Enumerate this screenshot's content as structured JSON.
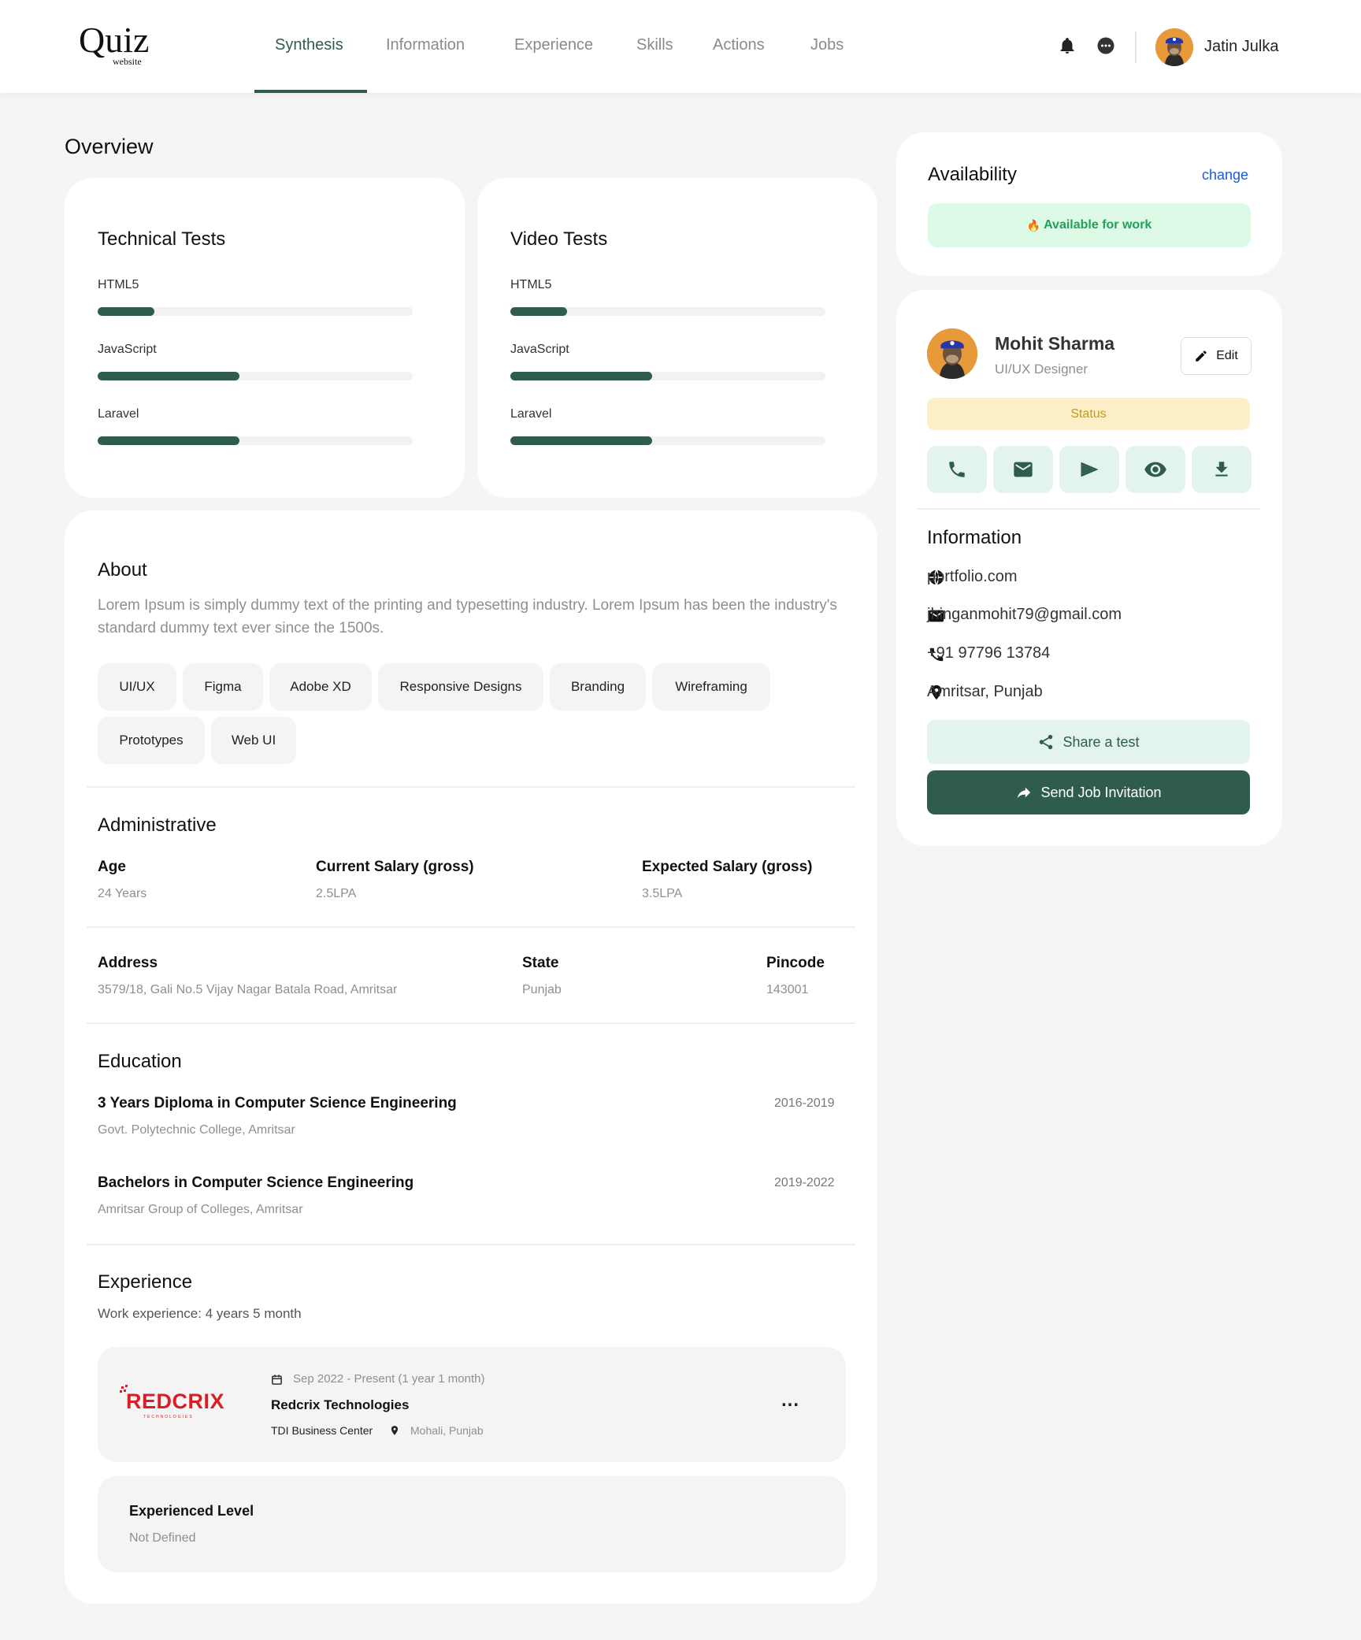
{
  "brand": {
    "name": "Quiz",
    "tagline": "website"
  },
  "nav": {
    "items": [
      "Synthesis",
      "Information",
      "Experience",
      "Skills",
      "Actions",
      "Jobs"
    ],
    "active": "Synthesis"
  },
  "header": {
    "user_name": "Jatin Julka",
    "icons": [
      "bell-icon",
      "chat-icon"
    ]
  },
  "overview": {
    "title": "Overview"
  },
  "technical_tests": {
    "title": "Technical Tests",
    "items": [
      {
        "label": "HTML5",
        "level": 0.18
      },
      {
        "label": "JavaScript",
        "level": 0.45
      },
      {
        "label": "Laravel",
        "level": 0.45
      }
    ]
  },
  "video_tests": {
    "title": "Video Tests",
    "items": [
      {
        "label": "HTML5",
        "level": 0.18
      },
      {
        "label": "JavaScript",
        "level": 0.45
      },
      {
        "label": "Laravel",
        "level": 0.45
      }
    ]
  },
  "about": {
    "title": "About",
    "text": "Lorem Ipsum is simply dummy text of the printing and typesetting industry. Lorem Ipsum has been the industry's standard dummy text ever since the 1500s.",
    "tags": [
      "UI/UX",
      "Figma",
      "Adobe XD",
      "Responsive Designs",
      "Branding",
      "Wireframing",
      "Prototypes",
      "Web UI"
    ]
  },
  "administrative": {
    "title": "Administrative",
    "age": {
      "label": "Age",
      "value": "24 Years"
    },
    "current_salary": {
      "label": "Current Salary (gross)",
      "value": "2.5LPA"
    },
    "expected_salary": {
      "label": "Expected Salary (gross)",
      "value": "3.5LPA"
    },
    "address": {
      "label": "Address",
      "value": "3579/18, Gali No.5 Vijay Nagar Batala Road, Amritsar"
    },
    "state": {
      "label": "State",
      "value": "Punjab"
    },
    "pincode": {
      "label": "Pincode",
      "value": "143001"
    }
  },
  "education": {
    "title": "Education",
    "items": [
      {
        "degree": "3 Years Diploma in Computer Science Engineering",
        "school": "Govt. Polytechnic College, Amritsar",
        "years": "2016-2019"
      },
      {
        "degree": "Bachelors in Computer Science Engineering",
        "school": "Amritsar Group of Colleges, Amritsar",
        "years": "2019-2022"
      }
    ]
  },
  "experience": {
    "title": "Experience",
    "summary": "Work experience: 4 years 5 month",
    "job": {
      "logo_text": "REDCRIX",
      "logo_sub": "TECHNOLOGIES",
      "period": "Sep 2022 - Present (1 year 1 month)",
      "company": "Redcrix Technologies",
      "office": "TDI Business Center",
      "location": "Mohali, Punjab",
      "more_label": "..."
    },
    "level": {
      "label": "Experienced Level",
      "value": "Not Defined"
    }
  },
  "availability": {
    "title": "Availability",
    "change_label": "change",
    "status": "Available for work",
    "emoji": "🔥"
  },
  "profile": {
    "name": "Mohit Sharma",
    "role": "UI/UX Designer",
    "edit_label": "Edit",
    "status_label": "Status",
    "actions": [
      "phone-icon",
      "mail-icon",
      "send-icon",
      "eye-icon",
      "download-icon"
    ]
  },
  "information": {
    "title": "Information",
    "website": "portfolio.com",
    "email": "jhinganmohit79@gmail.com",
    "phone": "+91 97796 13784",
    "location": "Amritsar, Punjab"
  },
  "cta": {
    "share": "Share a test",
    "invite": "Send Job Invitation"
  },
  "colors": {
    "accent": "#2f5c4b",
    "available_bg": "#dcfae6",
    "available_text": "#23a05a",
    "status_bg": "#fdf0c8",
    "status_text": "#c49a14",
    "icon_btn_bg": "#e3f4ec",
    "link": "#1e5bd6"
  }
}
